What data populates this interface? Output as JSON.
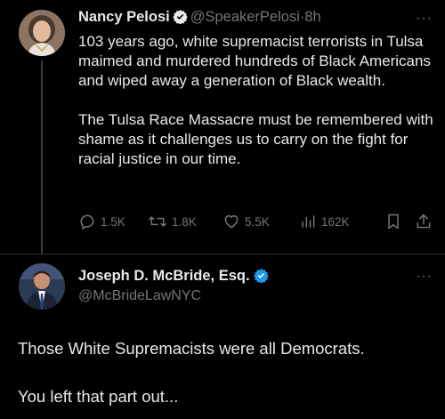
{
  "tweet": {
    "author_name": "Nancy Pelosi",
    "handle": "@SpeakerPelosi",
    "separator": "·",
    "time": "8h",
    "more_label": "···",
    "paragraphs": [
      "103 years ago, white supremacist terrorists in Tulsa maimed and murdered hundreds of Black Americans and wiped away a generation of Black wealth.",
      "The Tulsa Race Massacre must be remembered with shame as it challenges us to carry on the fight for racial justice in our time."
    ],
    "actions": {
      "replies": "1.5K",
      "reposts": "1.8K",
      "likes": "5.5K",
      "views": "162K"
    }
  },
  "reply": {
    "author_name": "Joseph D. McBride, Esq.",
    "handle": "@McBrideLawNYC",
    "more_label": "···",
    "paragraphs": [
      "Those White Supremacists were all Democrats.",
      "You left that part out..."
    ]
  },
  "colors": {
    "background": "#000000",
    "text": "#e7e9ea",
    "muted": "#71767b",
    "verified_blue": "#1d9bf0",
    "divider": "#2f3336"
  },
  "icons": {
    "reply": "reply-icon",
    "repost": "repost-icon",
    "like": "heart-icon",
    "views": "views-icon",
    "bookmark": "bookmark-icon",
    "share": "share-icon",
    "verified": "verified-badge-icon"
  }
}
